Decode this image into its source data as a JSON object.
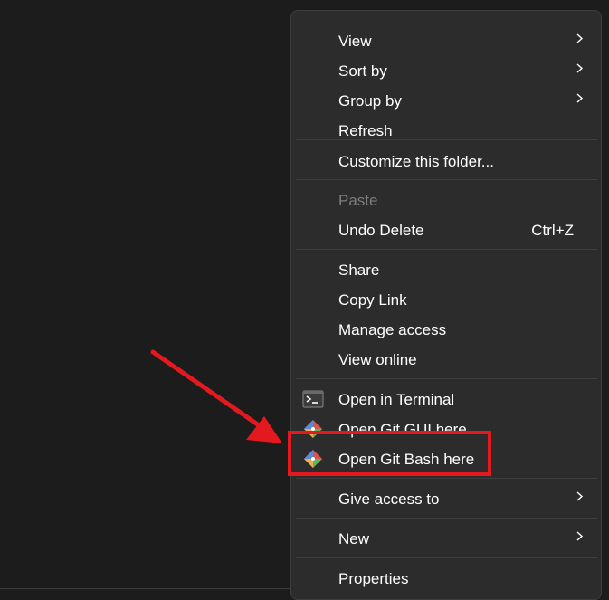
{
  "context_menu": {
    "items": [
      {
        "label": "View",
        "has_submenu": true
      },
      {
        "label": "Sort by",
        "has_submenu": true
      },
      {
        "label": "Group by",
        "has_submenu": true
      },
      {
        "label": "Refresh"
      },
      {
        "label": "Customize this folder..."
      },
      {
        "label": "Paste",
        "disabled": true
      },
      {
        "label": "Undo Delete",
        "shortcut": "Ctrl+Z"
      },
      {
        "label": "Share"
      },
      {
        "label": "Copy Link"
      },
      {
        "label": "Manage access"
      },
      {
        "label": "View online"
      },
      {
        "label": "Open in Terminal",
        "icon": "terminal-icon"
      },
      {
        "label": "Open Git GUI here",
        "icon": "git-icon"
      },
      {
        "label": "Open Git Bash here",
        "icon": "git-icon"
      },
      {
        "label": "Give access to",
        "has_submenu": true
      },
      {
        "label": "New",
        "has_submenu": true
      },
      {
        "label": "Properties"
      }
    ]
  },
  "annotation": {
    "highlight_color": "#e3191f",
    "highlighted_item": "Open Git Bash here"
  },
  "colors": {
    "menu_background": "#2c2c2c",
    "desktop_background": "#1c1c1c",
    "text": "#ffffff",
    "disabled_text": "#7d7d7d"
  }
}
